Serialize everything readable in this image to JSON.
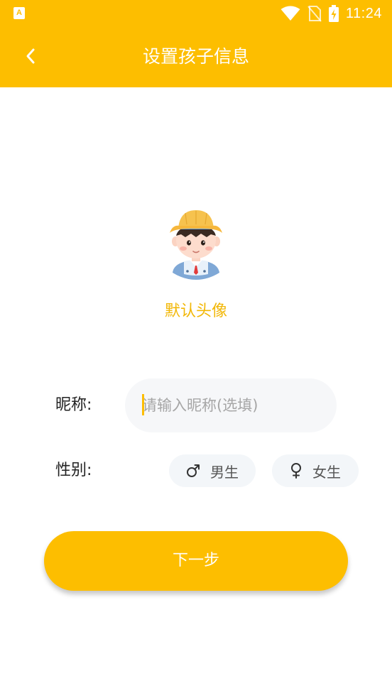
{
  "status_bar": {
    "time": "11:24",
    "app_icon_letter": "A",
    "icons": [
      "app-notification-icon",
      "wifi-icon",
      "no-sim-icon",
      "battery-charging-icon"
    ]
  },
  "header": {
    "title": "设置孩子信息",
    "back_icon": "chevron-left-icon"
  },
  "avatar": {
    "caption": "默认头像"
  },
  "form": {
    "nickname_label": "昵称:",
    "nickname_placeholder": "请输入昵称(选填)",
    "nickname_value": "",
    "gender_label": "性别:",
    "gender_options": [
      {
        "label": "男生",
        "icon": "male-symbol-icon"
      },
      {
        "label": "女生",
        "icon": "female-symbol-icon"
      }
    ]
  },
  "actions": {
    "next_label": "下一步"
  },
  "colors": {
    "brand": "#FDBE00",
    "caption": "#F2B706",
    "input_bg": "#F6F7F9",
    "chip_bg": "#F3F6F9"
  }
}
